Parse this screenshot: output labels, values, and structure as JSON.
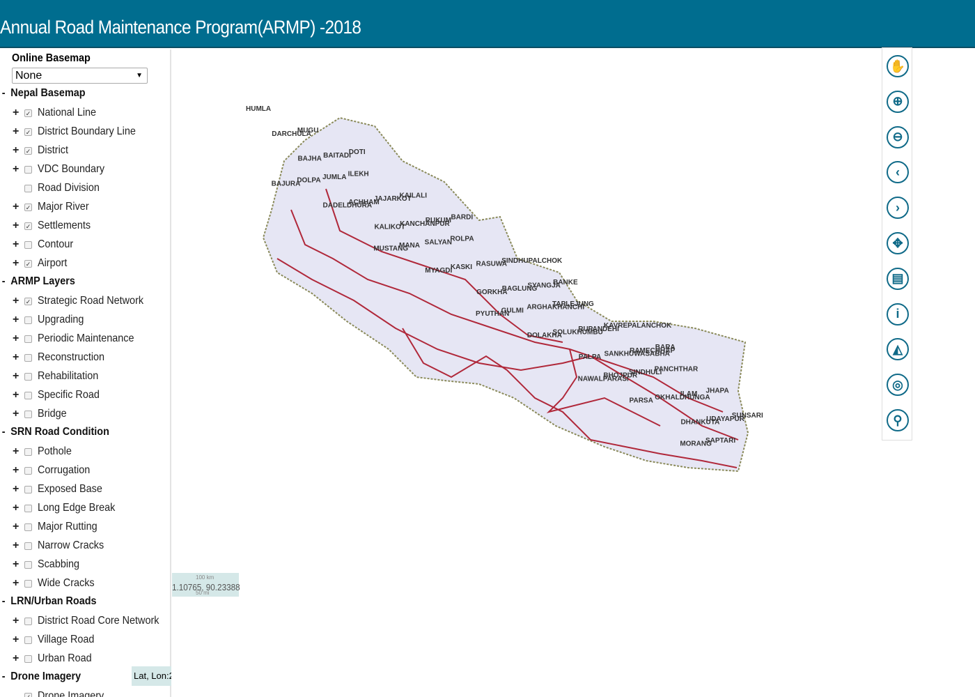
{
  "header": {
    "title": "Annual Road Maintenance Program(ARMP) -2018"
  },
  "sidebar": {
    "basemap_label": "Online Basemap",
    "basemap_value": "None",
    "groups": [
      {
        "label": "Nepal Basemap",
        "items": [
          {
            "label": "National Line",
            "checked": true,
            "expand": true
          },
          {
            "label": "District Boundary Line",
            "checked": true,
            "expand": true
          },
          {
            "label": "District",
            "checked": true,
            "expand": true
          },
          {
            "label": "VDC Boundary",
            "checked": false,
            "expand": true
          },
          {
            "label": "Road Division",
            "checked": false,
            "expand": false
          },
          {
            "label": "Major River",
            "checked": true,
            "expand": true
          },
          {
            "label": "Settlements",
            "checked": true,
            "expand": true
          },
          {
            "label": "Contour",
            "checked": false,
            "expand": true
          },
          {
            "label": "Airport",
            "checked": true,
            "expand": true
          }
        ]
      },
      {
        "label": "ARMP Layers",
        "items": [
          {
            "label": "Strategic Road Network",
            "checked": true,
            "expand": true
          },
          {
            "label": "Upgrading",
            "checked": false,
            "expand": true
          },
          {
            "label": "Periodic Maintenance",
            "checked": false,
            "expand": true
          },
          {
            "label": "Reconstruction",
            "checked": false,
            "expand": true
          },
          {
            "label": "Rehabilitation",
            "checked": false,
            "expand": true
          },
          {
            "label": "Specific Road",
            "checked": false,
            "expand": true
          },
          {
            "label": "Bridge",
            "checked": false,
            "expand": true
          }
        ]
      },
      {
        "label": "SRN Road Condition",
        "items": [
          {
            "label": "Pothole",
            "checked": false,
            "expand": true
          },
          {
            "label": "Corrugation",
            "checked": false,
            "expand": true
          },
          {
            "label": "Exposed Base",
            "checked": false,
            "expand": true
          },
          {
            "label": "Long Edge Break",
            "checked": false,
            "expand": true
          },
          {
            "label": "Major Rutting",
            "checked": false,
            "expand": true
          },
          {
            "label": "Narrow Cracks",
            "checked": false,
            "expand": true
          },
          {
            "label": "Scabbing",
            "checked": false,
            "expand": true
          },
          {
            "label": "Wide Cracks",
            "checked": false,
            "expand": true
          }
        ]
      },
      {
        "label": "LRN/Urban Roads",
        "items": [
          {
            "label": "District Road Core Network",
            "checked": false,
            "expand": true
          },
          {
            "label": "Village Road",
            "checked": false,
            "expand": true
          },
          {
            "label": "Urban Road",
            "checked": false,
            "expand": true
          }
        ]
      },
      {
        "label": "Drone Imagery",
        "items": [
          {
            "label": "Drone Imagery",
            "checked": true,
            "expand": false
          }
        ]
      }
    ]
  },
  "tools": [
    {
      "icon": "pan-hand-icon"
    },
    {
      "icon": "zoom-in-icon"
    },
    {
      "icon": "zoom-out-icon"
    },
    {
      "icon": "previous-extent-icon"
    },
    {
      "icon": "next-extent-icon"
    },
    {
      "icon": "full-extent-icon"
    },
    {
      "icon": "print-icon"
    },
    {
      "icon": "info-icon"
    },
    {
      "icon": "road-icon"
    },
    {
      "icon": "search-location-icon"
    },
    {
      "icon": "measure-distance-icon"
    }
  ],
  "map": {
    "scale_km": "100 km",
    "scale_mi": "50 mi",
    "coords": "1.10765, 90.23388",
    "latlon_label": "Lat, Lon:2",
    "labels": [
      "HUMLA",
      "DARCHULA",
      "BAJHA",
      "BAJURA",
      "MUGU",
      "BAITADI",
      "DOLPA",
      "DADELDHURA",
      "DOTI",
      "JUMLA",
      "ACHHAM",
      "KALIKOT",
      "ILEKH",
      "JAJARKOT",
      "KANCHANPUR",
      "MUSTANG",
      "KAILALI",
      "RUKUM",
      "MANA",
      "MYAGDI",
      "BARDI",
      "SALYAN",
      "KASKI",
      "GORKHA",
      "ROLPA",
      "RASUWA",
      "BAGLUNG",
      "PYUTHAN",
      "SINDHUPALCHOK",
      "SYANGJA",
      "GULMI",
      "DOLAKHA",
      "BANKE",
      "ARGHAKHANCHI",
      "SOLUKHUMBU",
      "PALPA",
      "TAPLEJUNG",
      "RUPANDEHI",
      "SANKHUWASABHA",
      "NAWALPARASI",
      "KAVREPALANCHOK",
      "RAMECHHAP",
      "BHOJPUR",
      "PARSA",
      "BARA",
      "SINDHULI",
      "OKHALDHUNGA",
      "DHANKUTA",
      "PANCHTHAR",
      "ILAM",
      "UDAYAPUR",
      "MORANG",
      "JHAPA",
      "SUNSARI",
      "SAPTARI"
    ]
  },
  "colors": {
    "header": "#006d8f",
    "tool": "#0f6a88",
    "road": "#b0283a",
    "scale_bg": "#d5e8e8"
  }
}
